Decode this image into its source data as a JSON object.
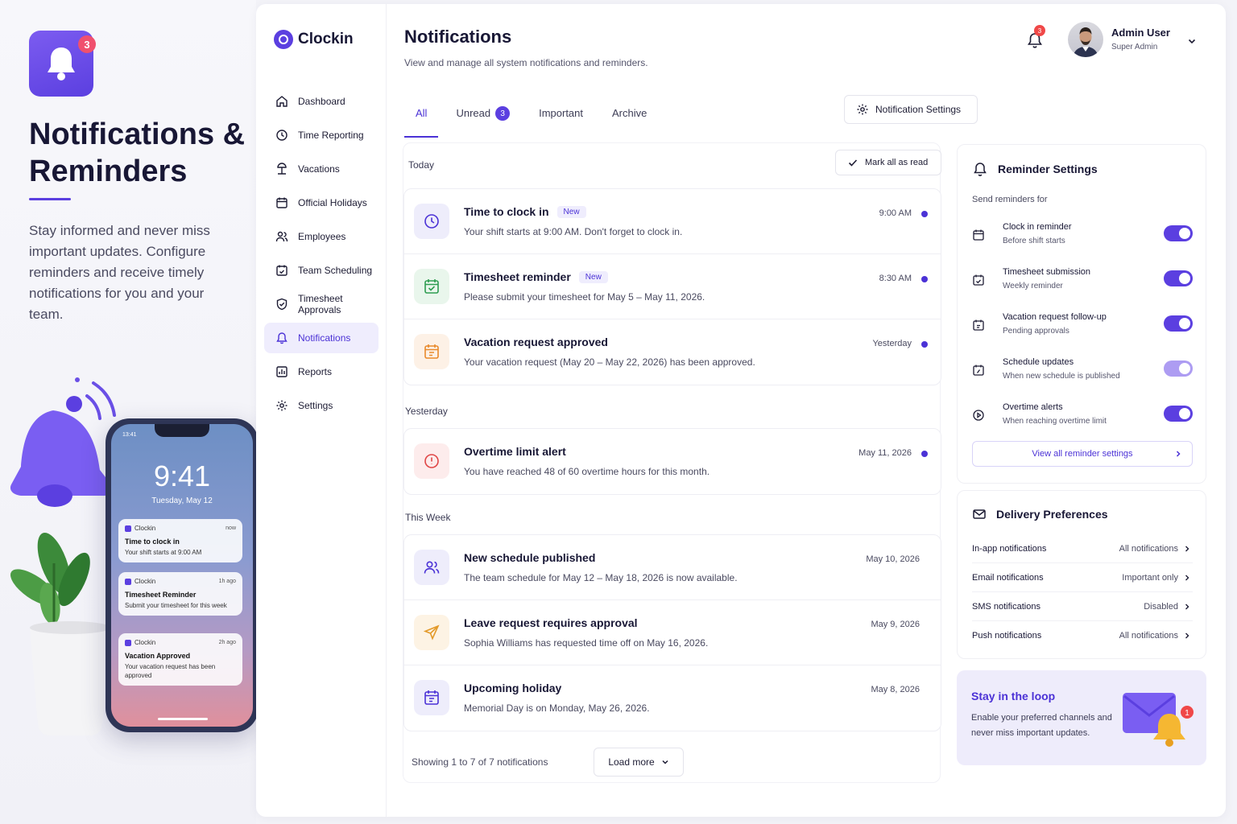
{
  "promo": {
    "badge": "3",
    "title": "Notifications & Reminders",
    "text": "Stay informed and never miss important updates. Configure reminders and receive timely notifications for you and your team.",
    "phone": {
      "status_time": "13:41",
      "clock": "9:41",
      "date": "Tuesday, May 12",
      "cards": [
        {
          "app": "Clockin",
          "when": "now",
          "title": "Time to clock in",
          "body": "Your shift starts at 9:00 AM"
        },
        {
          "app": "Clockin",
          "when": "1h ago",
          "title": "Timesheet Reminder",
          "body": "Submit your timesheet for this week"
        },
        {
          "app": "Clockin",
          "when": "2h ago",
          "title": "Vacation Approved",
          "body": "Your vacation request has been approved"
        }
      ]
    }
  },
  "brand": "Clockin",
  "nav": [
    {
      "label": "Dashboard",
      "icon": "home-icon"
    },
    {
      "label": "Time Reporting",
      "icon": "clock-icon"
    },
    {
      "label": "Vacations",
      "icon": "beach-icon"
    },
    {
      "label": "Official Holidays",
      "icon": "calendar-icon"
    },
    {
      "label": "Employees",
      "icon": "users-icon"
    },
    {
      "label": "Team Scheduling",
      "icon": "schedule-icon"
    },
    {
      "label": "Timesheet Approvals",
      "icon": "shield-check-icon"
    },
    {
      "label": "Notifications",
      "icon": "bell-icon",
      "active": true
    },
    {
      "label": "Reports",
      "icon": "chart-icon"
    },
    {
      "label": "Settings",
      "icon": "gear-icon"
    }
  ],
  "header": {
    "title": "Notifications",
    "subtitle": "View and manage all system notifications and reminders.",
    "bell_badge": "3",
    "user_name": "Admin User",
    "user_role": "Super Admin"
  },
  "tabs": [
    {
      "label": "All",
      "active": true
    },
    {
      "label": "Unread",
      "count": "3"
    },
    {
      "label": "Important"
    },
    {
      "label": "Archive"
    }
  ],
  "settings_button": "Notification Settings",
  "mark_all": "Mark all as read",
  "sections": {
    "today": "Today",
    "yesterday": "Yesterday",
    "this_week": "This Week"
  },
  "notifications": {
    "today": [
      {
        "title": "Time to clock in",
        "badge": "New",
        "body": "Your shift starts at 9:00 AM. Don't forget to clock in.",
        "time": "9:00 AM",
        "unread": true
      },
      {
        "title": "Timesheet reminder",
        "badge": "New",
        "body": "Please submit your timesheet for May 5 – May 11, 2026.",
        "time": "8:30 AM",
        "unread": true
      },
      {
        "title": "Vacation request approved",
        "body": "Your vacation request (May 20 – May 22, 2026) has been approved.",
        "time": "Yesterday",
        "unread": true
      }
    ],
    "yesterday": [
      {
        "title": "Overtime limit alert",
        "body": "You have reached 48 of 60 overtime hours for this month.",
        "time": "May 11, 2026",
        "unread": true
      }
    ],
    "this_week": [
      {
        "title": "New schedule published",
        "body": "The team schedule for May 12 – May 18, 2026 is now available.",
        "time": "May 10, 2026"
      },
      {
        "title": "Leave request requires approval",
        "body": "Sophia Williams has requested time off on May 16, 2026.",
        "time": "May 9, 2026"
      },
      {
        "title": "Upcoming holiday",
        "body": "Memorial Day is on Monday, May 26, 2026.",
        "time": "May 8, 2026"
      }
    ]
  },
  "footer": {
    "showing": "Showing 1 to 7 of 7 notifications",
    "load_more": "Load more"
  },
  "reminders": {
    "title": "Reminder Settings",
    "subtitle": "Send reminders for",
    "items": [
      {
        "title": "Clock in reminder",
        "desc": "Before shift starts",
        "on": true
      },
      {
        "title": "Timesheet submission",
        "desc": "Weekly reminder",
        "on": true
      },
      {
        "title": "Vacation request follow-up",
        "desc": "Pending approvals",
        "on": true
      },
      {
        "title": "Schedule updates",
        "desc": "When new schedule is published",
        "on": true
      },
      {
        "title": "Overtime alerts",
        "desc": "When reaching overtime limit",
        "on": true
      }
    ],
    "view_all": "View all reminder settings"
  },
  "delivery": {
    "title": "Delivery Preferences",
    "rows": [
      {
        "channel": "In-app notifications",
        "value": "All notifications"
      },
      {
        "channel": "Email notifications",
        "value": "Important only"
      },
      {
        "channel": "SMS notifications",
        "value": "Disabled"
      },
      {
        "channel": "Push notifications",
        "value": "All notifications"
      }
    ]
  },
  "loop": {
    "title": "Stay in the loop",
    "body": "Enable your preferred channels and never miss important updates.",
    "badge": "1"
  },
  "colors": {
    "accent": "#5b3fe0",
    "accent_soft": "#efedfd",
    "alert": "#f04848"
  }
}
